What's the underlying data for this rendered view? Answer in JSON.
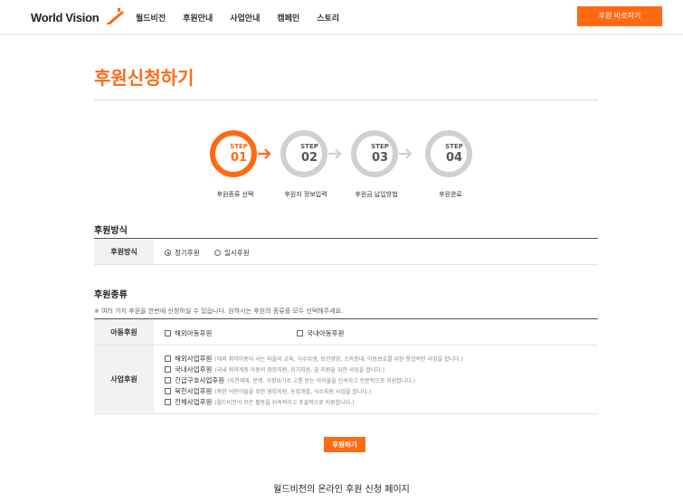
{
  "header": {
    "logo_text": "World Vision",
    "nav": [
      "월드비전",
      "후원안내",
      "사업안내",
      "캠페인",
      "스토리"
    ],
    "cta_label": "후원 바로하기"
  },
  "page_title": "후원신청하기",
  "steps": [
    {
      "step": "STEP",
      "num": "01",
      "label": "후원종류 선택",
      "active": true
    },
    {
      "step": "STEP",
      "num": "02",
      "label": "후원자 정보입력",
      "active": false
    },
    {
      "step": "STEP",
      "num": "03",
      "label": "후원금 납입방법",
      "active": false
    },
    {
      "step": "STEP",
      "num": "04",
      "label": "후원완료",
      "active": false
    }
  ],
  "method_section": {
    "title": "후원방식",
    "row_label": "후원방식",
    "options": [
      {
        "label": "정기후원",
        "selected": true
      },
      {
        "label": "일시후원",
        "selected": false
      }
    ]
  },
  "type_section": {
    "title": "후원종류",
    "note": "※ 여러 가지 후원을 한번에 신청하실 수 있습니다. 원하시는 후원의 종류를 모두 선택해주세요.",
    "child_row": {
      "label": "아동후원",
      "options": [
        "해외아동후원",
        "국내아동후원"
      ]
    },
    "project_row": {
      "label": "사업후원",
      "options": [
        {
          "name": "해외사업후원",
          "desc": "(해외 취약아동이 사는 마을의 교육, 식수위생, 보건영양, 소득증대, 아동보호를 위한 통합적인 사업을 합니다.)"
        },
        {
          "name": "국내사업후원",
          "desc": "(국내 취약계층 아동의 영양지원, 위기지원, 꿈 지원을 위한 사업을 합니다.)"
        },
        {
          "name": "긴급구호사업후원",
          "desc": "(자연재해, 분쟁, 식량위기로 고통 받는 아이들을 신속하고 전문적으로 지원합니다.)"
        },
        {
          "name": "북한사업후원",
          "desc": "(북한 어린이들을 위한 영양지원, 농업개발, 식수지원 사업을 합니다.)"
        },
        {
          "name": "전체사업후원",
          "desc": "(월드비전의 모든 활동을 지속적이고 포괄적으로 지원합니다.)"
        }
      ]
    }
  },
  "submit_label": "후원하기",
  "caption": "월드비전의 온라인 후원 신청 페이지",
  "colors": {
    "accent": "#ff6a13",
    "inactive_ring": "#d0d0d0"
  }
}
